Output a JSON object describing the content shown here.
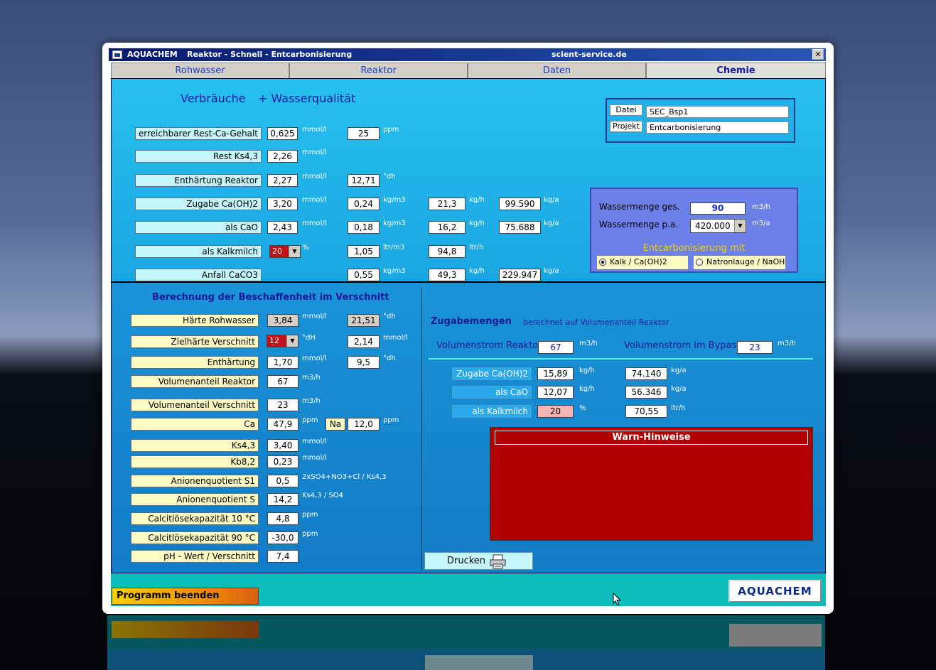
{
  "window": {
    "app": "AQUACHEM",
    "title": "Reaktor - Schnell - Entcarbonisierung",
    "site": "scient-service.de",
    "close": "✕"
  },
  "tabs": [
    "Rohwasser",
    "Reaktor",
    "Daten",
    "Chemie"
  ],
  "top": {
    "heading1": "Verbräuche",
    "heading2": "+ Wasserqualität",
    "rows": [
      {
        "label": "erreichbarer Rest-Ca-Gehalt",
        "v1": "0,625",
        "u1": "mmol/l",
        "v2": "25",
        "u2": "ppm"
      },
      {
        "label": "Rest  Ks4,3",
        "v1": "2,26",
        "u1": "mmol/l"
      },
      {
        "label": "Enthärtung Reaktor",
        "v1": "2,27",
        "u1": "mmol/l",
        "v2": "12,71",
        "u2": "°dh"
      },
      {
        "label": "Zugabe  Ca(OH)2",
        "v1": "3,20",
        "u1": "mmol/l",
        "v2": "0,24",
        "u2": "kg/m3",
        "v3": "21,3",
        "u3": "kg/h",
        "v4": "99.590",
        "u4": "kg/a"
      },
      {
        "label": "als  CaO",
        "v1": "2,43",
        "u1": "mmol/l",
        "v2": "0,18",
        "u2": "kg/m3",
        "v3": "16,2",
        "u3": "kg/h",
        "v4": "75.688",
        "u4": "kg/a"
      },
      {
        "label": "als Kalkmilch",
        "combo": "20",
        "u1": "%",
        "v2": "1,05",
        "u2": "ltr/m3",
        "v3": "94,8",
        "u3": "ltr/h"
      },
      {
        "label": "Anfall  CaCO3",
        "v2": "0,55",
        "u2": "kg/m3",
        "v3": "49,3",
        "u3": "kg/h",
        "v4": "229.947",
        "u4": "kg/a"
      }
    ],
    "file": {
      "datei_label": "Datei",
      "datei": "SEC_Bsp1",
      "projekt_label": "Projekt",
      "projekt": "Entcarbonisierung"
    },
    "water": {
      "ges_label": "Wassermenge  ges.",
      "ges": "90",
      "ges_unit": "m3/h",
      "pa_label": "Wassermenge   p.a.",
      "pa": "420.000",
      "pa_unit": "m3/a",
      "mit": "Entcarbonisierung mit",
      "opt1": "Kalk / Ca(OH)2",
      "opt2": "Natronlauge / NaOH"
    }
  },
  "lower_left": {
    "heading": "Berechnung der Beschaffenheit im Verschnitt",
    "rows": [
      {
        "label": "Härte Rohwasser",
        "v1": "3,84",
        "u1": "mmol/l",
        "v2": "21,51",
        "u2": "°dh",
        "gray": true
      },
      {
        "label": "Zielhärte Verschnitt",
        "combo": "12",
        "u1": "°dH",
        "v2": "2,14",
        "u2": "mmol/l"
      },
      {
        "label": "Enthärtung",
        "v1": "1,70",
        "u1": "mmol/l",
        "v2": "9,5",
        "u2": "°dh"
      },
      {
        "label": "Volumenanteil  Reaktor",
        "v1": "67",
        "u1": "m3/h"
      },
      {
        "label": "Volumenanteil Verschnitt",
        "v1": "23",
        "u1": "m3/h"
      },
      {
        "label": "Ca",
        "v1": "47,9",
        "u1": "ppm",
        "na_label": "Na",
        "v2": "12,0",
        "u2": "ppm"
      },
      {
        "label": "Ks4,3",
        "v1": "3,40",
        "u1": "mmol/l"
      },
      {
        "label": "Kb8,2",
        "v1": "0,23",
        "u1": "mmol/l"
      },
      {
        "label": "Anionenquotient S1",
        "v1": "0,5",
        "u1": "2xSO4+NO3+Cl / Ks4,3"
      },
      {
        "label": "Anionenquotient S",
        "v1": "14,2",
        "u1": "Ks4,3 / SO4"
      },
      {
        "label": "Calcitlösekapazität  10 °C",
        "v1": "4,8",
        "u1": "ppm"
      },
      {
        "label": "Calcitlösekapazität  90 °C",
        "v1": "-30,0",
        "u1": "ppm"
      },
      {
        "label": "pH - Wert / Verschnitt",
        "v1": "7,4"
      }
    ]
  },
  "lower_right": {
    "heading": "Zugabemengen",
    "sub": "berechnet  auf  Volumenanteil  Reaktor",
    "vr_label": "Volumenstrom Reaktor",
    "vr": "67",
    "vr_unit": "m3/h",
    "vb_label": "Volumenstrom im Bypass",
    "vb": "23",
    "vb_unit": "m3/h",
    "rows": [
      {
        "label": "Zugabe Ca(OH)2",
        "v1": "15,89",
        "u1": "kg/h",
        "v2": "74.140",
        "u2": "kg/a"
      },
      {
        "label": "als CaO",
        "v1": "12,07",
        "u1": "kg/h",
        "v2": "56.346",
        "u2": "kg/a"
      },
      {
        "label": "als Kalkmilch",
        "v1": "20",
        "u1": "%",
        "v2": "70,55",
        "u2": "ltr/h"
      }
    ],
    "warn": "Warn-Hinweise",
    "print": "Drucken"
  },
  "bottom": {
    "quit": "Programm  beenden",
    "logo": "AQUACHEM"
  }
}
